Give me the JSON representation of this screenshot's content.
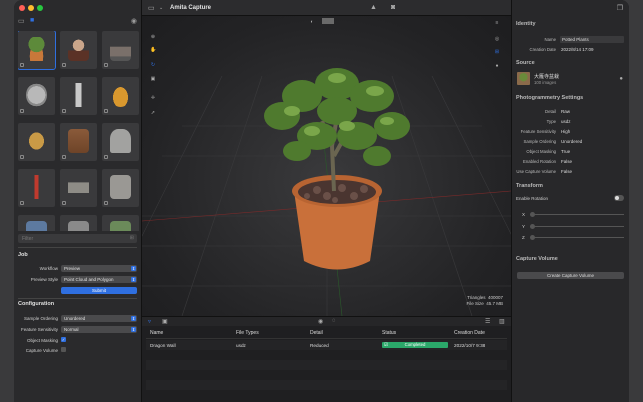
{
  "window": {
    "title": "Amita Capture"
  },
  "sidebar": {
    "filter_placeholder": "Filter",
    "job": {
      "heading": "Job",
      "workflow_label": "Workflow",
      "workflow_value": "Preview",
      "preview_style_label": "Preview Style",
      "preview_style_value": "Point Cloud and Polygon",
      "submit_label": "Submit"
    },
    "configuration": {
      "heading": "Configuration",
      "sample_ordering_label": "Sample Ordering",
      "sample_ordering_value": "Unordered",
      "feature_sensitivity_label": "Feature Sensitivity",
      "feature_sensitivity_value": "Normal",
      "object_masking_label": "Object Masking",
      "capture_volume_label": "Capture Volume"
    }
  },
  "viewport": {
    "triangles_label": "Triangles",
    "triangles_value": "400007",
    "file_size_label": "File Size",
    "file_size_value": "45.7 MB"
  },
  "table": {
    "headers": {
      "name": "Name",
      "file_types": "File Types",
      "detail": "Detail",
      "status": "Status",
      "creation_date": "Creation Date"
    },
    "rows": [
      {
        "name": "Dragon Wall",
        "file_types": "usdz",
        "detail": "Reduced",
        "status": "Completed",
        "creation_date": "2022/10/7 9:38"
      }
    ]
  },
  "inspector": {
    "identity": {
      "heading": "Identity",
      "name_label": "Name",
      "name_value": "Potted Plants",
      "creation_date_label": "Creation Date",
      "creation_date_value": "2022/8/14 17:09"
    },
    "source": {
      "heading": "Source",
      "title": "大雁寺盆栽",
      "subtitle": "100 images"
    },
    "photogrammetry": {
      "heading": "Photogrammetry Settings",
      "detail_label": "Detail",
      "detail_value": "Raw",
      "type_label": "Type",
      "type_value": "usdz",
      "feature_sensitivity_label": "Feature Sensitivity",
      "feature_sensitivity_value": "High",
      "sample_ordering_label": "Sample Ordering",
      "sample_ordering_value": "Unordered",
      "object_masking_label": "Object Masking",
      "object_masking_value": "True",
      "enabled_rotation_label": "Enabled Rotation",
      "enabled_rotation_value": "False",
      "use_capture_volume_label": "Use Capture Volume",
      "use_capture_volume_value": "False"
    },
    "transform": {
      "heading": "Transform",
      "enable_rotation_label": "Enable Rotation",
      "x_label": "X",
      "y_label": "Y",
      "z_label": "Z"
    },
    "capture_volume": {
      "heading": "Capture Volume",
      "button_label": "Create Capture Volume"
    }
  },
  "colors": {
    "accent": "#2f6fe0",
    "status_completed": "#2ba86a"
  }
}
